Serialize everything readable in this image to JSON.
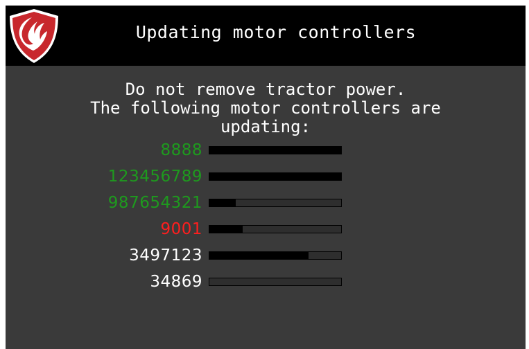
{
  "header": {
    "title": "Updating motor controllers",
    "logo_icon": "shield-logo-icon",
    "logo_colors": {
      "shield": "#c8282d",
      "swoosh": "#ffffff"
    }
  },
  "message": {
    "line1": "Do not remove tractor power.",
    "line2": "The following motor controllers are",
    "line3": "updating:"
  },
  "controllers": [
    {
      "id": "8888",
      "color": "#1e9a1e",
      "progress": 1.0
    },
    {
      "id": "123456789",
      "color": "#1e9a1e",
      "progress": 1.0
    },
    {
      "id": "987654321",
      "color": "#1e9a1e",
      "progress": 0.2
    },
    {
      "id": "9001",
      "color": "#ff1e1e",
      "progress": 0.25
    },
    {
      "id": "3497123",
      "color": "#ffffff",
      "progress": 0.75
    },
    {
      "id": "34869",
      "color": "#ffffff",
      "progress": 0.0
    }
  ]
}
